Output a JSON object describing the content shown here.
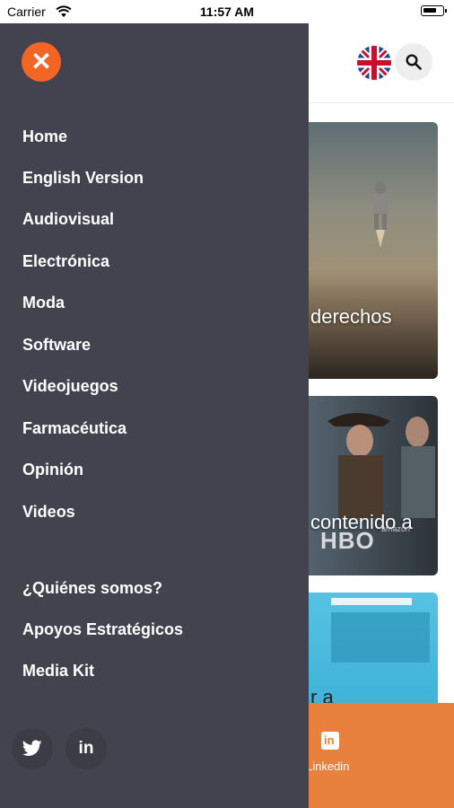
{
  "status_bar": {
    "carrier": "Carrier",
    "time": "11:57 AM"
  },
  "drawer": {
    "menu_items": [
      "Home",
      "English Version",
      "Audiovisual",
      "Electrónica",
      "Moda",
      "Software",
      "Videojuegos",
      "Farmacéutica",
      "Opinión",
      "Videos"
    ],
    "secondary_items": [
      "¿Quiénes somos?",
      "Apoyos Estratégicos",
      "Media Kit"
    ],
    "social": {
      "twitter_icon": "twitter-icon",
      "linkedin_label": "in"
    }
  },
  "background": {
    "cards": [
      {
        "title": "derechos"
      },
      {
        "title": "contenido a",
        "logo": "HBO",
        "sub_logo": "amazon"
      },
      {
        "title": "r a"
      }
    ],
    "share": {
      "icon_text": "in",
      "label": "Linkedin"
    }
  },
  "colors": {
    "drawer_bg": "#43434f",
    "accent": "#f26524",
    "share_bar": "#e8803e"
  }
}
